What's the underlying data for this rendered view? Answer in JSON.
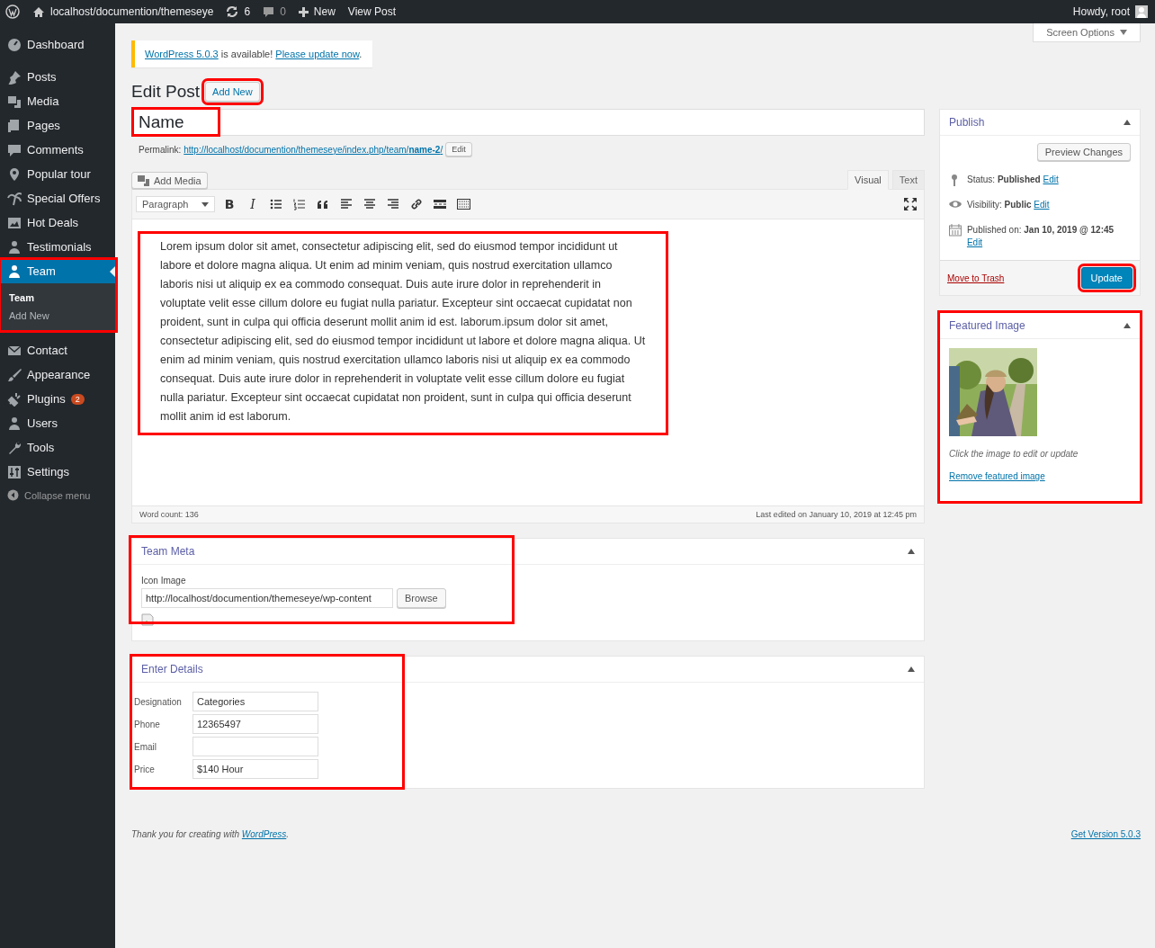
{
  "admin_bar": {
    "site": "localhost/documention/themeseye",
    "updates": "6",
    "comments": "0",
    "new": "New",
    "view": "View Post",
    "greeting": "Howdy, root"
  },
  "sidebar": {
    "items": [
      {
        "label": "Dashboard",
        "selected": false
      },
      {
        "label": "Posts",
        "selected": false
      },
      {
        "label": "Media",
        "selected": false
      },
      {
        "label": "Pages",
        "selected": false
      },
      {
        "label": "Comments",
        "selected": false
      },
      {
        "label": "Popular tour",
        "selected": false
      },
      {
        "label": "Special Offers",
        "selected": false
      },
      {
        "label": "Hot Deals",
        "selected": false
      },
      {
        "label": "Testimonials",
        "selected": false
      },
      {
        "label": "Team",
        "selected": true,
        "highlighted": true,
        "children": [
          {
            "label": "Team",
            "selected": true
          },
          {
            "label": "Add New",
            "selected": false
          }
        ]
      },
      {
        "label": "Contact",
        "selected": false
      },
      {
        "label": "Appearance",
        "selected": false
      },
      {
        "label": "Plugins",
        "selected": false,
        "badge": "2"
      },
      {
        "label": "Users",
        "selected": false
      },
      {
        "label": "Tools",
        "selected": false
      },
      {
        "label": "Settings",
        "selected": false
      }
    ],
    "collapse": "Collapse menu"
  },
  "screen_options": "Screen Options",
  "notice": {
    "link": "WordPress 5.0.3",
    "text": " is available! ",
    "action": "Please update now",
    "end": "."
  },
  "heading": "Edit Post",
  "add_new": {
    "label": "Add New",
    "highlighted": true
  },
  "title": {
    "value": "Name",
    "highlighted": true
  },
  "permalink": {
    "label": "Permalink:",
    "url": "http://localhost/documention/themeseye/index.php/team/**name-2**/",
    "edit": "Edit"
  },
  "editor": {
    "add_media": "Add Media",
    "tabs": [
      {
        "label": "Visual",
        "selected": true
      },
      {
        "label": "Text",
        "selected": false
      }
    ],
    "format": "Paragraph",
    "toolbar": [
      {
        "kind": "bold",
        "label": "B"
      },
      {
        "kind": "italic",
        "label": "I"
      },
      {
        "kind": "bullets"
      },
      {
        "kind": "numbers"
      },
      {
        "kind": "quote"
      },
      {
        "kind": "align-left"
      },
      {
        "kind": "align-center"
      },
      {
        "kind": "align-right"
      },
      {
        "kind": "link"
      },
      {
        "kind": "more"
      },
      {
        "kind": "keyboard"
      }
    ],
    "content": "Lorem ipsum dolor sit amet, consectetur adipiscing elit, sed do eiusmod tempor incididunt ut labore et dolore magna aliqua. Ut enim ad minim veniam, quis nostrud exercitation ullamco laboris nisi ut aliquip ex ea commodo consequat. Duis aute irure dolor in reprehenderit in voluptate velit esse cillum dolore eu fugiat nulla pariatur. Excepteur sint occaecat cupidatat non proident, sunt in culpa qui officia deserunt mollit anim id est. laborum.ipsum dolor sit amet, consectetur adipiscing elit, sed do eiusmod tempor incididunt ut labore et dolore magna aliqua. Ut enim ad minim veniam, quis nostrud exercitation ullamco laboris nisi ut aliquip ex ea commodo consequat. Duis aute irure dolor in reprehenderit in voluptate velit esse cillum dolore eu fugiat nulla pariatur. Excepteur sint occaecat cupidatat non proident, sunt in culpa qui officia deserunt mollit anim id est laborum.",
    "highlighted": true,
    "word_count": "Word count: 136",
    "last_edited": "Last edited on January 10, 2019 at 12:45 pm"
  },
  "team_meta": {
    "title": "Team Meta",
    "highlighted": true,
    "label": "Icon Image",
    "value": "http://localhost/documention/themeseye/wp-content",
    "button": "Browse"
  },
  "enter_details": {
    "title": "Enter Details",
    "highlighted": true,
    "fields": [
      {
        "label": "Designation",
        "value": "Categories"
      },
      {
        "label": "Phone",
        "value": "12365497"
      },
      {
        "label": "Email"
      },
      {
        "label": "Price",
        "value": "$140 Hour"
      }
    ]
  },
  "publish": {
    "title": "Publish",
    "preview": "Preview Changes",
    "rows": [
      {
        "kind": "status",
        "text": "Status: **Published**",
        "edit": "Edit"
      },
      {
        "kind": "visibility",
        "text": "Visibility: **Public**",
        "edit": "Edit"
      },
      {
        "kind": "date",
        "text": "Published on: **Jan 10, 2019 @ 12:45**",
        "edit": "Edit"
      }
    ],
    "trash": "Move to Trash",
    "update": {
      "label": "Update",
      "highlighted": true
    }
  },
  "featured_image": {
    "title": "Featured Image",
    "highlighted": true,
    "hint": "Click the image to edit or update",
    "remove": "Remove featured image"
  },
  "footer": {
    "text": "Thank you for creating with ",
    "link": "WordPress",
    "end": ".",
    "version": "Get Version 5.0.3"
  }
}
